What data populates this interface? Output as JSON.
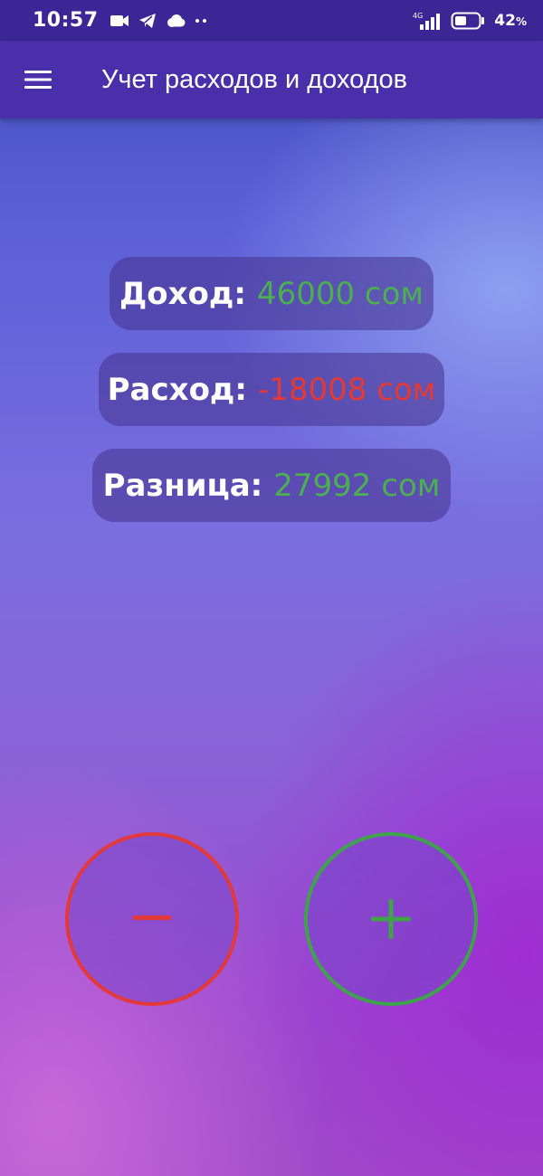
{
  "status_bar": {
    "time": "10:57",
    "network": "4G",
    "battery_percent": "42",
    "battery_unit": "%"
  },
  "app_bar": {
    "title": "Учет расходов и доходов",
    "menu_icon": "hamburger-menu-icon"
  },
  "summary": {
    "income": {
      "label": "Доход:",
      "value": "46000 сом",
      "color": "#4caf50"
    },
    "expense": {
      "label": "Расход:",
      "value": "-18008 сом",
      "color": "#e53935"
    },
    "difference": {
      "label": "Разница:",
      "value": "27992 сом",
      "color": "#4caf50"
    }
  },
  "actions": {
    "subtract": {
      "icon": "minus-icon",
      "color": "#e4393b"
    },
    "add": {
      "icon": "plus-icon",
      "color": "#3fa34c"
    }
  }
}
